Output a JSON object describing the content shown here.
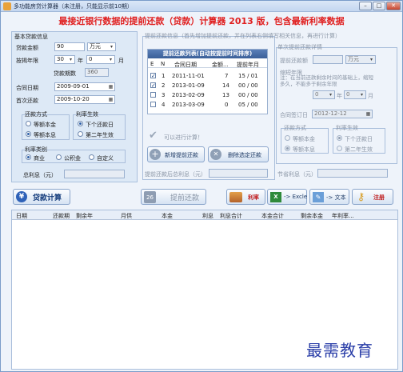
{
  "window": {
    "title": "多功能房贷计算器（未注册，只能显示前10期）",
    "min": "–",
    "max": "□",
    "close": "✕"
  },
  "banner": "最接近银行数据的提前还款（贷款）计算器 2013 版，包含最新利率数据",
  "basic": {
    "title": "基本贷款信息",
    "amount_label": "贷款金额",
    "amount_value": "90",
    "amount_unit": "万元",
    "term_label": "按揭年限",
    "term_years": "30",
    "year_char": "年",
    "term_months": "0",
    "month_char": "月",
    "periods_label": "贷款期数",
    "periods_value": "360",
    "contract_label": "合同日期",
    "contract_value": "2009-09-01",
    "first_label": "首次还款",
    "first_value": "2009-10-20",
    "repay_title": "还款方式",
    "repay_opt1": "等额本金",
    "repay_opt2": "等额本息",
    "rate_eff_title": "利率生效",
    "rate_eff_opt1": "下个还款日",
    "rate_eff_opt2": "第二年生效",
    "rate_type_title": "利率类别",
    "rate_type_opt1": "商业",
    "rate_type_opt2": "公积金",
    "rate_type_opt3": "自定义",
    "total_interest_label": "总利息（元）"
  },
  "prepay": {
    "title": "提前还款信息（首先增加提前还款，并在列表右侧填写相关信息，再进行计算）",
    "list_title": "提前还款列表(自动按提前时间排序)",
    "columns": [
      "E",
      "N",
      "合同日期",
      "金额...",
      "提前年月"
    ],
    "rows": [
      {
        "checked": "✓",
        "n": "1",
        "date": "2011-11-01",
        "amount": "7",
        "ym": "15 / 01"
      },
      {
        "checked": "✓",
        "n": "2",
        "date": "2013-01-09",
        "amount": "14",
        "ym": "00 / 00"
      },
      {
        "checked": "",
        "n": "3",
        "date": "2013-02-09",
        "amount": "13",
        "ym": "00 / 00"
      },
      {
        "checked": "",
        "n": "4",
        "date": "2013-03-09",
        "amount": "0",
        "ym": "05 / 00"
      }
    ],
    "can_calc": "可以进行计算！",
    "add_btn": "新增提前还款",
    "del_btn": "删除选定还款",
    "after_interest_label": "提前还款后总利息（元）"
  },
  "detail": {
    "title": "单次提前还款详情",
    "amount_label": "提前还款额",
    "amount_unit": "万元",
    "term_label": "缩短年限",
    "note": "注：在当前还款剩余时间的基础上，缩短多久，不能多于剩余年限",
    "term_years": "0",
    "year_char": "年",
    "term_months": "0",
    "month_char": "月",
    "date_label": "合同签订日",
    "date_value": "2012-12-12",
    "repay_title": "还款方式",
    "repay_opt1": "等额本金",
    "repay_opt2": "等额本息",
    "rate_eff_title": "利率生效",
    "rate_eff_opt1": "下个还款日",
    "rate_eff_opt2": "第二年生效",
    "saved_label": "节省利息（元）"
  },
  "toolbar": {
    "loan_calc": "贷款计算",
    "day_num": "26",
    "prepay_calc": "提前还款",
    "rate": "利率",
    "excel": "-> Excle",
    "text": "-> 文本",
    "register": "注册"
  },
  "result_columns": [
    "日期",
    "还款期",
    "剩余年",
    "月供",
    "本金",
    "利息",
    "利息合计",
    "本金合计",
    "剩余本金",
    "年利率..."
  ],
  "watermark": "最需教育"
}
